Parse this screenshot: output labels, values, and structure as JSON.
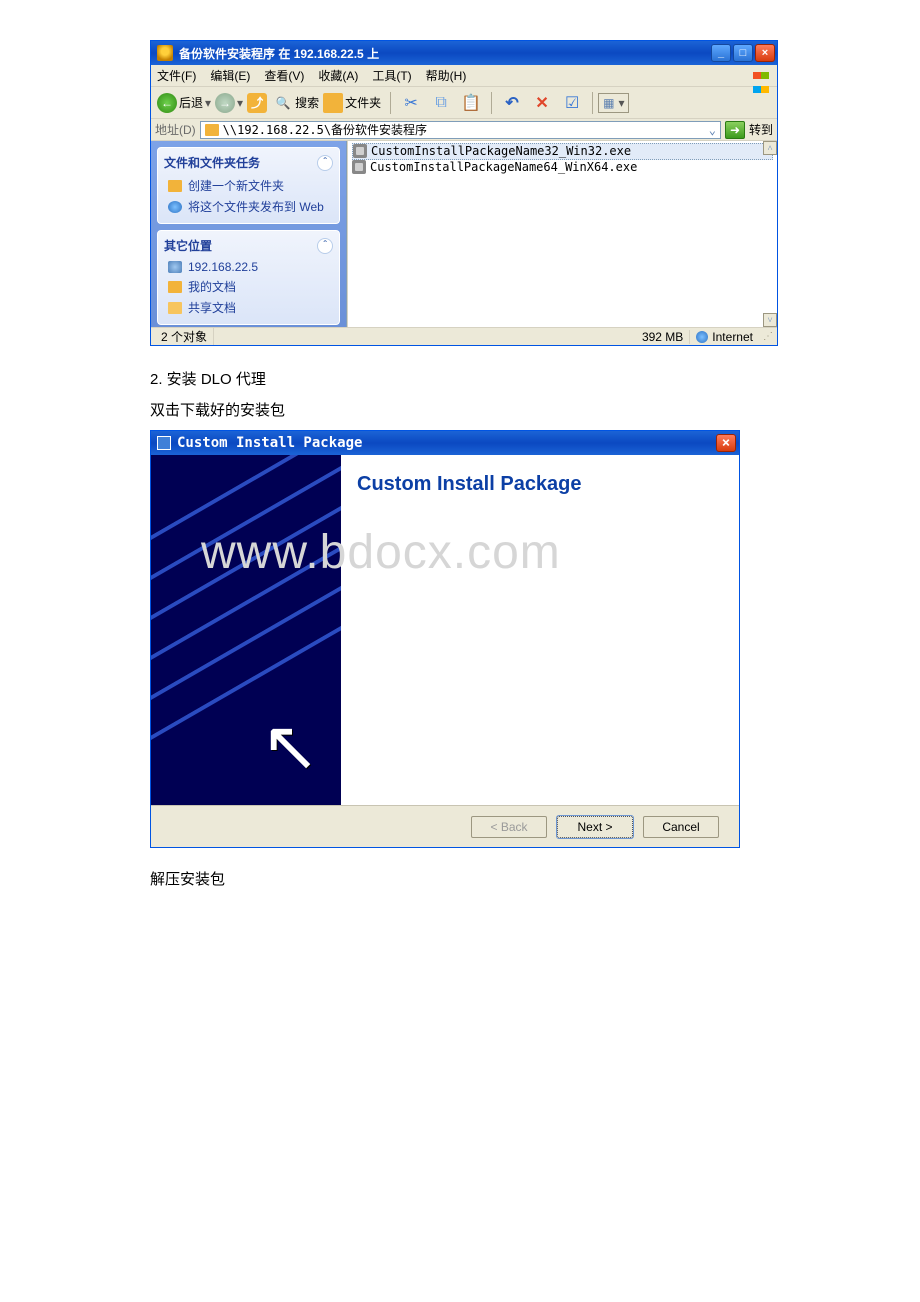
{
  "explorer": {
    "title": "备份软件安装程序 在 192.168.22.5 上",
    "menu": {
      "file": "文件(F)",
      "edit": "编辑(E)",
      "view": "查看(V)",
      "favorites": "收藏(A)",
      "tools": "工具(T)",
      "help": "帮助(H)"
    },
    "toolbar": {
      "back": "后退",
      "search": "搜索",
      "folders": "文件夹"
    },
    "address": {
      "label": "地址(D)",
      "path": "\\\\192.168.22.5\\备份软件安装程序",
      "go": "转到"
    },
    "sidebar": {
      "tasks_title": "文件和文件夹任务",
      "task_new_folder": "创建一个新文件夹",
      "task_publish": "将这个文件夹发布到 Web",
      "other_title": "其它位置",
      "loc_ip": "192.168.22.5",
      "loc_mydocs": "我的文档",
      "loc_shareddocs": "共享文档"
    },
    "files": {
      "file1": "CustomInstallPackageName32_Win32.exe",
      "file2": "CustomInstallPackageName64_WinX64.exe"
    },
    "status": {
      "objects": "2 个对象",
      "size": "392 MB",
      "zone": "Internet"
    }
  },
  "body": {
    "step2": "2. 安装 DLO 代理",
    "bullet1": " 双击下载好的安装包",
    "bullet2": " 解压安装包"
  },
  "installer": {
    "title": "Custom Install Package",
    "heading": "Custom Install Package",
    "watermark": "www.bdocx.com",
    "buttons": {
      "back": "< Back",
      "next": "Next >",
      "cancel": "Cancel"
    }
  }
}
